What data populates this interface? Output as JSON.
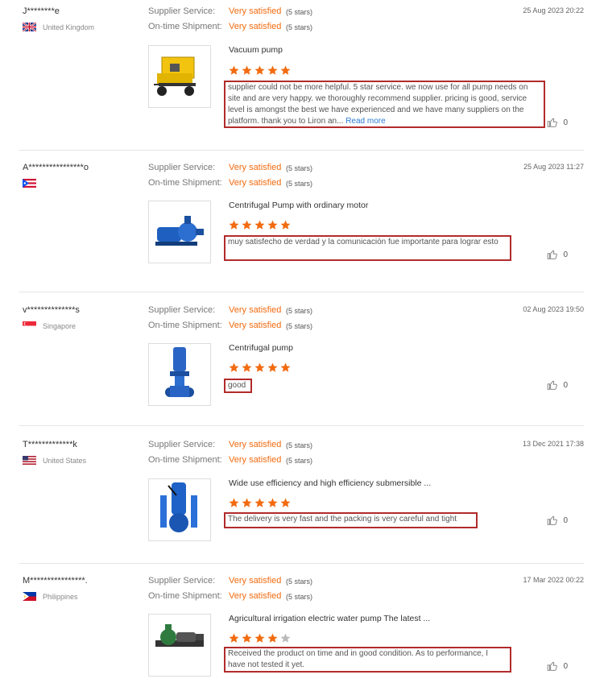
{
  "labels": {
    "supplier_service": "Supplier Service:",
    "ontime_shipment": "On-time Shipment:"
  },
  "reviews": [
    {
      "user": "J********e",
      "country": "United Kingdom",
      "date": "25 Aug 2023 20:22",
      "service_rating": "Very satisfied",
      "service_stars": "(5 stars)",
      "shipment_rating": "Very satisfied",
      "shipment_stars": "(5 stars)",
      "product": "Vacuum pump",
      "star_count": 5,
      "comment": "supplier could not be more helpful. 5 star service. we now use for all pump needs on site and are very happy. we thoroughly recommend supplier. pricing is good, service level is amongst the best we have experienced and we have many suppliers on the platform. thank you to Liron an...",
      "read_more": "Read more",
      "likes": "0"
    },
    {
      "user": "A****************o",
      "country": "",
      "date": "25 Aug 2023 11:27",
      "service_rating": "Very satisfied",
      "service_stars": "(5 stars)",
      "shipment_rating": "Very satisfied",
      "shipment_stars": "(5 stars)",
      "product": "Centrifugal Pump with ordinary motor",
      "star_count": 5,
      "comment": "muy satisfecho de verdad y la comunicación fue importante para lograr esto",
      "likes": "0"
    },
    {
      "user": "v**************s",
      "country": "Singapore",
      "date": "02 Aug 2023 19:50",
      "service_rating": "Very satisfied",
      "service_stars": "(5 stars)",
      "shipment_rating": "Very satisfied",
      "shipment_stars": "(5 stars)",
      "product": "Centrifugal pump",
      "star_count": 5,
      "comment": "good",
      "likes": "0"
    },
    {
      "user": "T*************k",
      "country": "United States",
      "date": "13 Dec 2021 17:38",
      "service_rating": "Very satisfied",
      "service_stars": "(5 stars)",
      "shipment_rating": "Very satisfied",
      "shipment_stars": "(5 stars)",
      "product": "Wide use efficiency and high efficiency submersible ...",
      "star_count": 5,
      "comment": "The delivery is very fast and the packing is very careful and tight",
      "likes": "0"
    },
    {
      "user": "M****************.",
      "country": "Philippines",
      "date": "17 Mar 2022 00:22",
      "service_rating": "Very satisfied",
      "service_stars": "(5 stars)",
      "shipment_rating": "Very satisfied",
      "shipment_stars": "(5 stars)",
      "product": "Agricultural irrigation electric water pump The latest ...",
      "star_count": 4,
      "comment": "Received the product on time and in good condition. As to performance, I have not tested it yet.",
      "likes": "0"
    }
  ],
  "colors": {
    "accent": "#f26b10",
    "highlight_border": "#b22b2b",
    "link": "#2c7bd4"
  }
}
